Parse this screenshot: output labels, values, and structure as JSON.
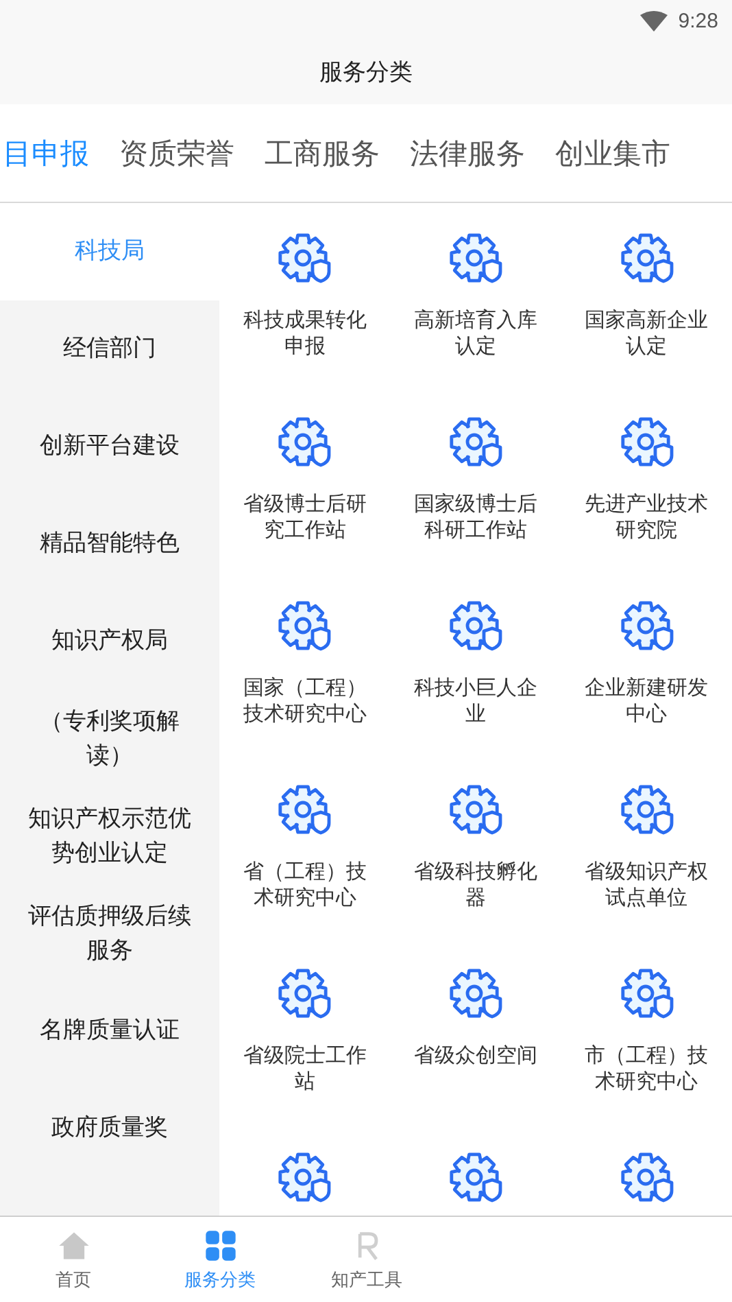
{
  "status_bar": {
    "time": "9:28"
  },
  "header": {
    "title": "服务分类"
  },
  "tabs": [
    {
      "label": "目申报",
      "selected": true
    },
    {
      "label": "资质荣誉",
      "selected": false
    },
    {
      "label": "工商服务",
      "selected": false
    },
    {
      "label": "法律服务",
      "selected": false
    },
    {
      "label": "创业集市",
      "selected": false
    }
  ],
  "sidebar": {
    "items": [
      {
        "label": "科技局",
        "selected": true
      },
      {
        "label": "经信部门",
        "selected": false
      },
      {
        "label": "创新平台建设",
        "selected": false
      },
      {
        "label": "精品智能特色",
        "selected": false
      },
      {
        "label": "知识产权局",
        "selected": false
      },
      {
        "label": "（专利奖项解读）",
        "selected": false
      },
      {
        "label": "知识产权示范优势创业认定",
        "selected": false
      },
      {
        "label": "评估质押级后续服务",
        "selected": false
      },
      {
        "label": "名牌质量认证",
        "selected": false
      },
      {
        "label": "政府质量奖",
        "selected": false
      }
    ]
  },
  "services": [
    {
      "kind": "labeled",
      "label": "科技成果转化申报"
    },
    {
      "kind": "labeled",
      "label": "高新培育入库认定"
    },
    {
      "kind": "labeled",
      "label": "国家高新企业认定"
    },
    {
      "kind": "labeled",
      "label": "省级博士后研究工作站"
    },
    {
      "kind": "labeled",
      "label": "国家级博士后科研工作站"
    },
    {
      "kind": "labeled",
      "label": "先进产业技术研究院"
    },
    {
      "kind": "labeled",
      "label": "国家（工程）技术研究中心"
    },
    {
      "kind": "labeled",
      "label": "科技小巨人企业"
    },
    {
      "kind": "labeled",
      "label": "企业新建研发中心"
    },
    {
      "kind": "labeled",
      "label": "省（工程）技术研究中心"
    },
    {
      "kind": "labeled",
      "label": "省级科技孵化器"
    },
    {
      "kind": "labeled",
      "label": "省级知识产权试点单位"
    },
    {
      "kind": "labeled",
      "label": "省级院士工作站"
    },
    {
      "kind": "labeled",
      "label": "省级众创空间"
    },
    {
      "kind": "labeled",
      "label": "市（工程）技术研究中心"
    },
    {
      "kind": "icon_only"
    },
    {
      "kind": "icon_only"
    },
    {
      "kind": "icon_only"
    }
  ],
  "bottom_nav": [
    {
      "label": "首页",
      "kind": "home",
      "selected": false
    },
    {
      "label": "服务分类",
      "kind": "grid",
      "selected": true
    },
    {
      "label": "知产工具",
      "kind": "r",
      "selected": false
    }
  ]
}
